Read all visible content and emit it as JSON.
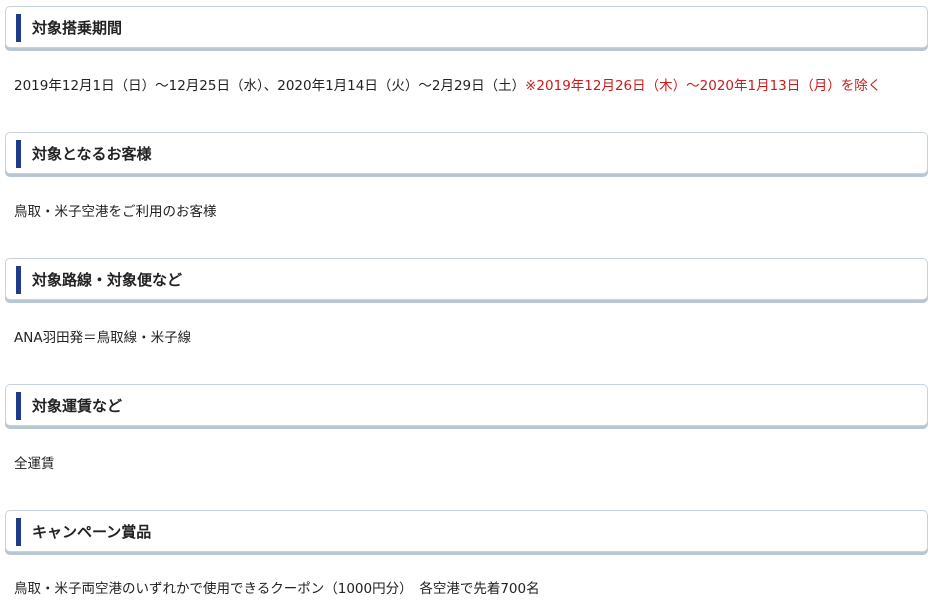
{
  "sections": [
    {
      "heading": "対象搭乗期間",
      "body": "2019年12月1日（日）～12月25日（水）、2020年1月14日（火）～2月29日（土）",
      "note": "※2019年12月26日（木）～2020年1月13日（月）を除く"
    },
    {
      "heading": "対象となるお客様",
      "body": "鳥取・米子空港をご利用のお客様"
    },
    {
      "heading": "対象路線・対象便など",
      "body": "ANA羽田発＝鳥取線・米子線"
    },
    {
      "heading": "対象運賃など",
      "body": "全運賃"
    },
    {
      "heading": "キャンペーン賞品",
      "body": "鳥取・米子両空港のいずれかで使用できるクーポン（1000円分）　各空港で先着700名"
    }
  ],
  "colors": {
    "accent_bar": "#1e3a8a",
    "note_red": "#cc1a1a",
    "box_border": "#c9d3dc",
    "box_shadow": "#b6c6d3"
  }
}
